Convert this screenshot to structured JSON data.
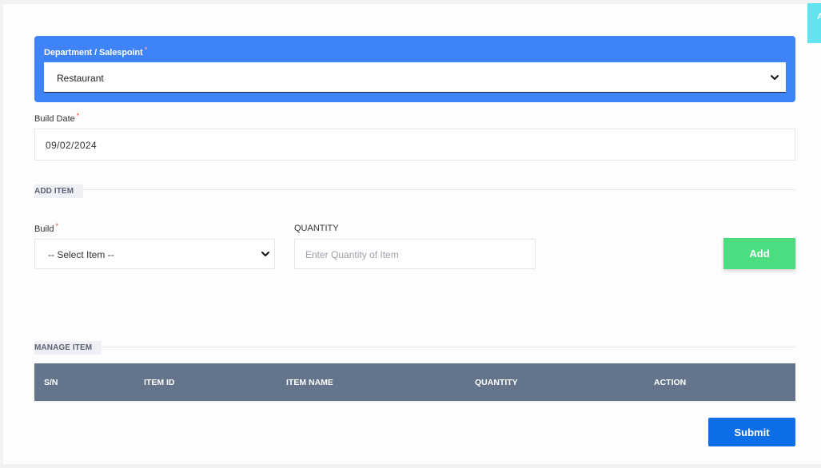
{
  "corner_tab": {
    "label": "A"
  },
  "department": {
    "label": "Department / Salespoint",
    "required_mark": "*",
    "selected_value": "Restaurant"
  },
  "build_date": {
    "label": "Build Date",
    "required_mark": "*",
    "value": "09/02/2024"
  },
  "add_item": {
    "title": "ADD ITEM",
    "build_label": "Build",
    "build_required_mark": "*",
    "build_select_value": "-- Select Item --",
    "quantity_label": "QUANTITY",
    "quantity_placeholder": "Enter Quantity of Item",
    "add_button": "Add"
  },
  "manage_item": {
    "title": "MANAGE ITEM",
    "columns": [
      "S/N",
      "ITEM ID",
      "ITEM NAME",
      "QUANTITY",
      "ACTION"
    ],
    "rows": []
  },
  "submit_button": "Submit",
  "colors": {
    "primary_blue": "#3f83f8",
    "add_green": "#4ade80",
    "submit_blue": "#0d6fe8",
    "table_header": "#64748b",
    "required_red": "#ef4444"
  }
}
